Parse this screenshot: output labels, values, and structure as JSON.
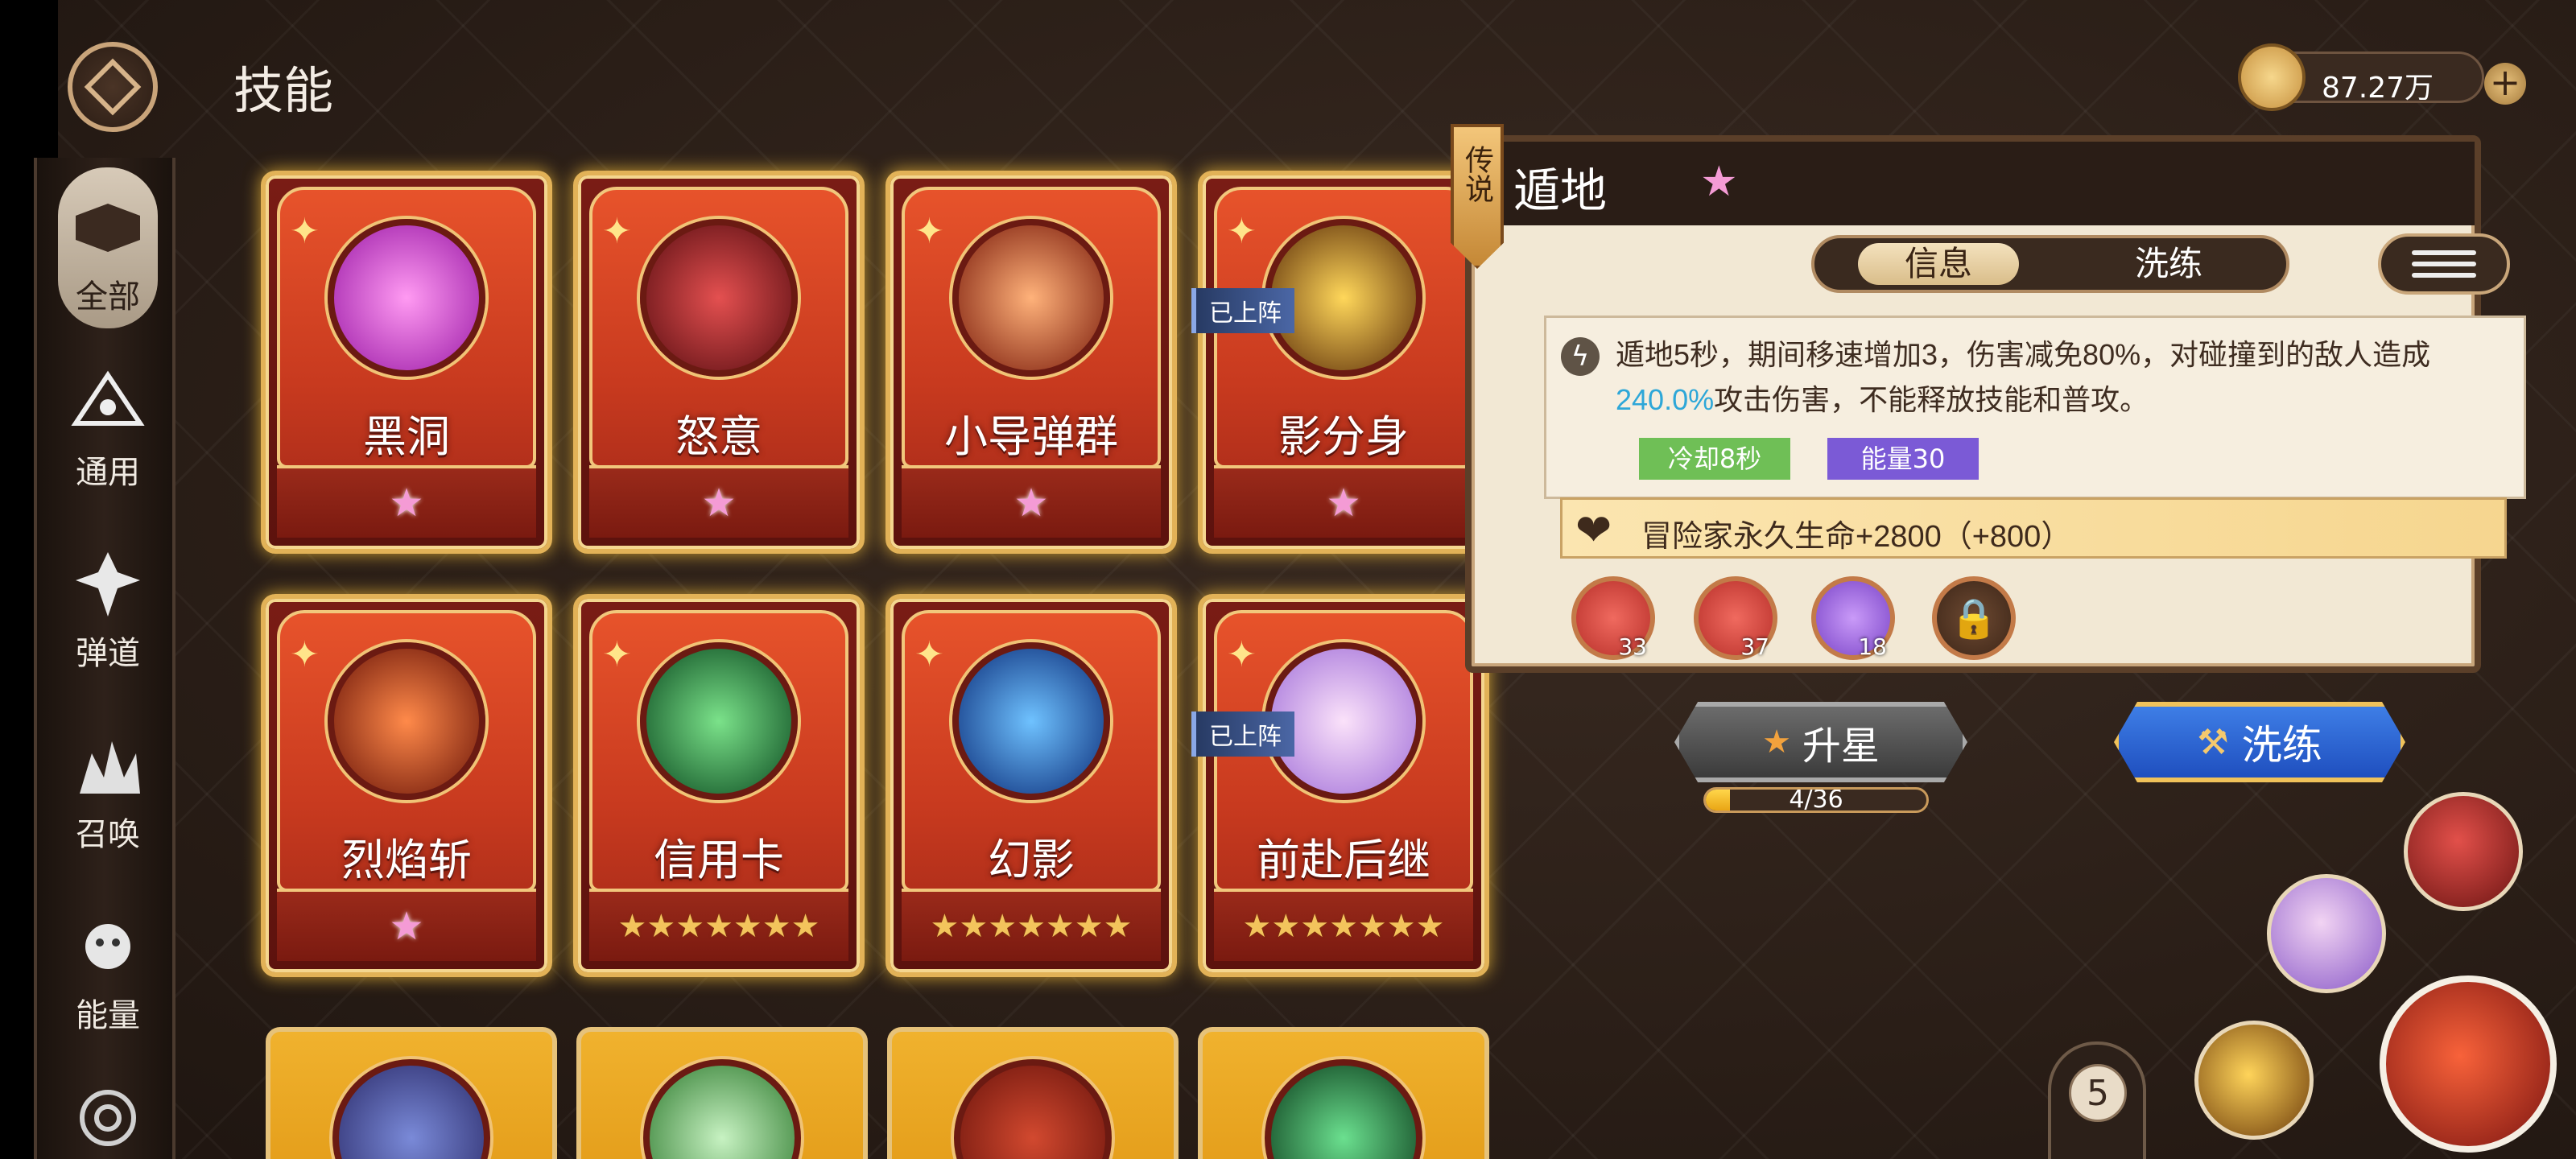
{
  "header": {
    "title": "技能"
  },
  "currency": {
    "amount": "87.27万",
    "plus": "+"
  },
  "nav": {
    "items": [
      {
        "label": "全部",
        "icon": "all-icon",
        "active": true
      },
      {
        "label": "通用",
        "icon": "general-icon"
      },
      {
        "label": "弹道",
        "icon": "projectile-icon"
      },
      {
        "label": "召唤",
        "icon": "summon-icon"
      },
      {
        "label": "能量",
        "icon": "energy-icon"
      }
    ]
  },
  "cards": [
    {
      "name": "黑洞",
      "stars": "pink",
      "color": "#c837c9"
    },
    {
      "name": "怒意",
      "stars": "pink",
      "color": "#8b1e22"
    },
    {
      "name": "小导弹群",
      "stars": "pink",
      "color": "#a33a1d"
    },
    {
      "name": "影分身",
      "stars": "pink",
      "badge": "已上阵",
      "color": "#f2a71f"
    },
    {
      "name": "烈焰斩",
      "stars": "pink",
      "color": "#c83d1f"
    },
    {
      "name": "信用卡",
      "stars": "gold",
      "color": "#1f7d3c"
    },
    {
      "name": "幻影",
      "stars": "gold",
      "color": "#1d5bd6"
    },
    {
      "name": "前赴后继",
      "stars": "gold",
      "badge": "已上阵",
      "color": "#e6a7e6"
    }
  ],
  "detail": {
    "rarity": "传说",
    "name": "遁地",
    "tabs": [
      "信息",
      "洗练"
    ],
    "desc_part1": "遁地5秒，期间移速增加3，伤害减免80%，对碰撞到的敌人造成",
    "desc_highlight": "240.0%",
    "desc_part2": "攻击伤害，不能释放技能和普攻。",
    "cooldown": "冷却8秒",
    "energy": "能量30",
    "bonus": "冒险家永久生命+2800（+800）",
    "runes": [
      {
        "num": "33",
        "type": "red"
      },
      {
        "num": "37",
        "type": "red"
      },
      {
        "num": "18",
        "type": "purple"
      },
      {
        "num": "",
        "type": "locked"
      }
    ]
  },
  "actions": {
    "upstar": "升星",
    "progress_text": "4/36",
    "progress_fraction": 0.111,
    "reforge": "洗练"
  },
  "slot": {
    "count": "5"
  }
}
